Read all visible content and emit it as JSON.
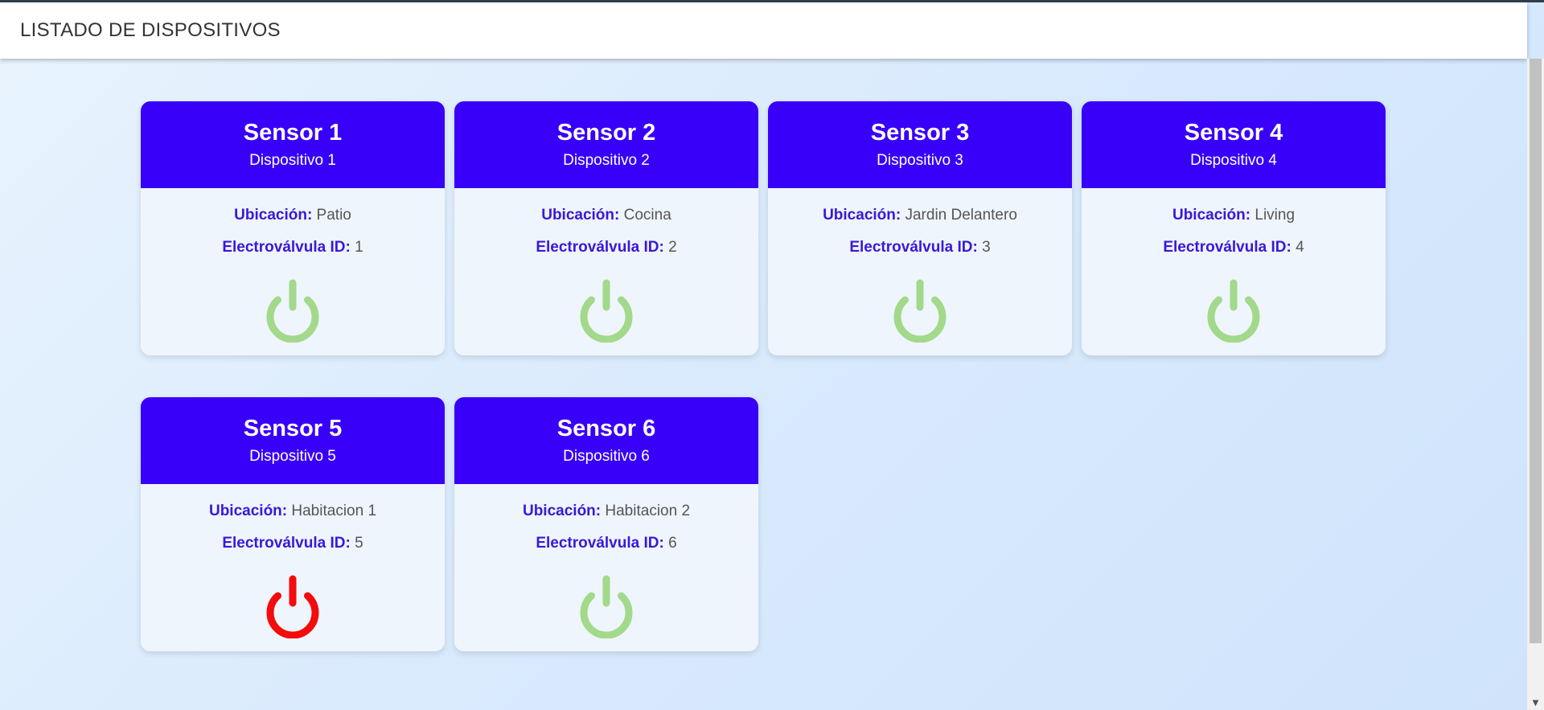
{
  "toolbar": {
    "title": "LISTADO DE DISPOSITIVOS"
  },
  "labels": {
    "location": "Ubicación:",
    "valve": "Electroválvula ID:"
  },
  "colors": {
    "header": "#3800f8",
    "on": "#a3d98a",
    "off": "#f40b0b"
  },
  "devices": [
    {
      "name": "Sensor 1",
      "device": "Dispositivo 1",
      "location": "Patio",
      "valve_id": "1",
      "state": "on"
    },
    {
      "name": "Sensor 2",
      "device": "Dispositivo 2",
      "location": "Cocina",
      "valve_id": "2",
      "state": "on"
    },
    {
      "name": "Sensor 3",
      "device": "Dispositivo 3",
      "location": "Jardin Delantero",
      "valve_id": "3",
      "state": "on"
    },
    {
      "name": "Sensor 4",
      "device": "Dispositivo 4",
      "location": "Living",
      "valve_id": "4",
      "state": "on"
    },
    {
      "name": "Sensor 5",
      "device": "Dispositivo 5",
      "location": "Habitacion 1",
      "valve_id": "5",
      "state": "off"
    },
    {
      "name": "Sensor 6",
      "device": "Dispositivo 6",
      "location": "Habitacion 2",
      "valve_id": "6",
      "state": "on"
    }
  ]
}
